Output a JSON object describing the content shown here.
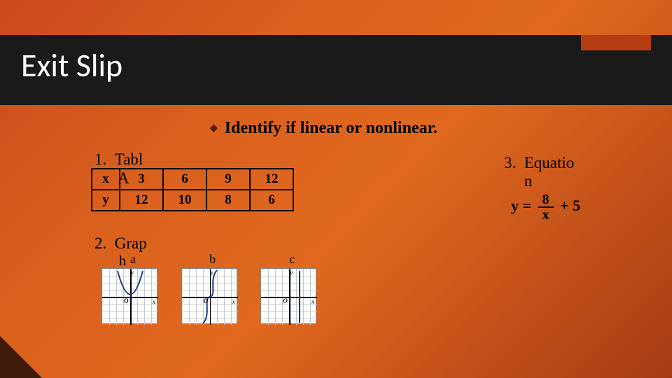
{
  "title": "Exit Slip",
  "instruction": "Identify if linear or nonlinear.",
  "q1": {
    "num": "1.",
    "label": "Tabl",
    "sublabel": "A"
  },
  "table": {
    "rows": [
      {
        "h": "x",
        "c": [
          "3",
          "6",
          "9",
          "12"
        ]
      },
      {
        "h": "y",
        "c": [
          "12",
          "10",
          "8",
          "6"
        ]
      }
    ]
  },
  "q2": {
    "num": "2.",
    "label": "Grap",
    "sublabel": "h"
  },
  "graphs": [
    {
      "label": "a"
    },
    {
      "label": "b"
    },
    {
      "label": "c"
    }
  ],
  "q3": {
    "num": "3.",
    "label": "Equatio",
    "sublabel": "n"
  },
  "equation": {
    "lhs": "y =",
    "num": "8",
    "den": "x",
    "tail": "+ 5"
  },
  "chart_data": {
    "table": {
      "type": "table",
      "columns": [
        "x",
        "y"
      ],
      "rows": [
        [
          3,
          12
        ],
        [
          6,
          10
        ],
        [
          9,
          8
        ],
        [
          12,
          6
        ]
      ]
    },
    "mini_graphs": [
      {
        "label": "a",
        "type": "line",
        "description": "upward parabola (nonlinear)"
      },
      {
        "label": "b",
        "type": "line",
        "description": "cubic / s-curve through origin (nonlinear)"
      },
      {
        "label": "c",
        "type": "line",
        "description": "vertical line (nonlinear as function of x)"
      }
    ],
    "equation": {
      "expr": "y = 8/x + 5",
      "form": "rational",
      "linear": false
    }
  }
}
